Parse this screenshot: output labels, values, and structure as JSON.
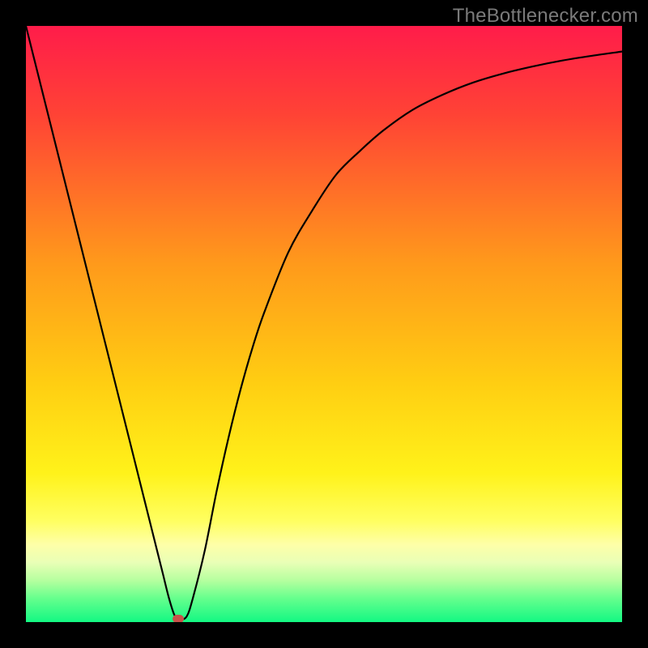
{
  "watermark": {
    "text": "TheBottlenecker.com"
  },
  "chart_data": {
    "type": "line",
    "title": "",
    "xlabel": "",
    "ylabel": "",
    "xlim": [
      0,
      100
    ],
    "ylim": [
      0,
      100
    ],
    "gradient_stops": [
      {
        "pct": 0,
        "color": "#ff1c4a"
      },
      {
        "pct": 15,
        "color": "#ff4335"
      },
      {
        "pct": 40,
        "color": "#ff9a1b"
      },
      {
        "pct": 60,
        "color": "#ffce12"
      },
      {
        "pct": 75,
        "color": "#fff21a"
      },
      {
        "pct": 83,
        "color": "#ffff60"
      },
      {
        "pct": 87,
        "color": "#feffa8"
      },
      {
        "pct": 90,
        "color": "#e9ffb6"
      },
      {
        "pct": 93,
        "color": "#b6ff9f"
      },
      {
        "pct": 96,
        "color": "#66ff8d"
      },
      {
        "pct": 100,
        "color": "#13f883"
      }
    ],
    "series": [
      {
        "name": "bottleneck-curve",
        "x": [
          0,
          2,
          4,
          6,
          8,
          10,
          12,
          14,
          16,
          18,
          20,
          22,
          23,
          24,
          25,
          26,
          27,
          28,
          30,
          32,
          34,
          36,
          38,
          40,
          44,
          48,
          52,
          56,
          60,
          65,
          70,
          75,
          80,
          85,
          90,
          95,
          100
        ],
        "y": [
          100,
          92,
          84,
          76,
          68,
          60,
          52,
          44,
          36,
          28,
          20,
          12,
          8,
          4,
          1,
          0.5,
          1,
          4,
          12,
          22,
          31,
          39,
          46,
          52,
          62,
          69,
          75,
          79,
          82.5,
          86,
          88.5,
          90.5,
          92,
          93.2,
          94.2,
          95,
          95.7
        ]
      }
    ],
    "marker": {
      "x": 25.5,
      "y": 0.5,
      "color": "#c9524a"
    }
  }
}
